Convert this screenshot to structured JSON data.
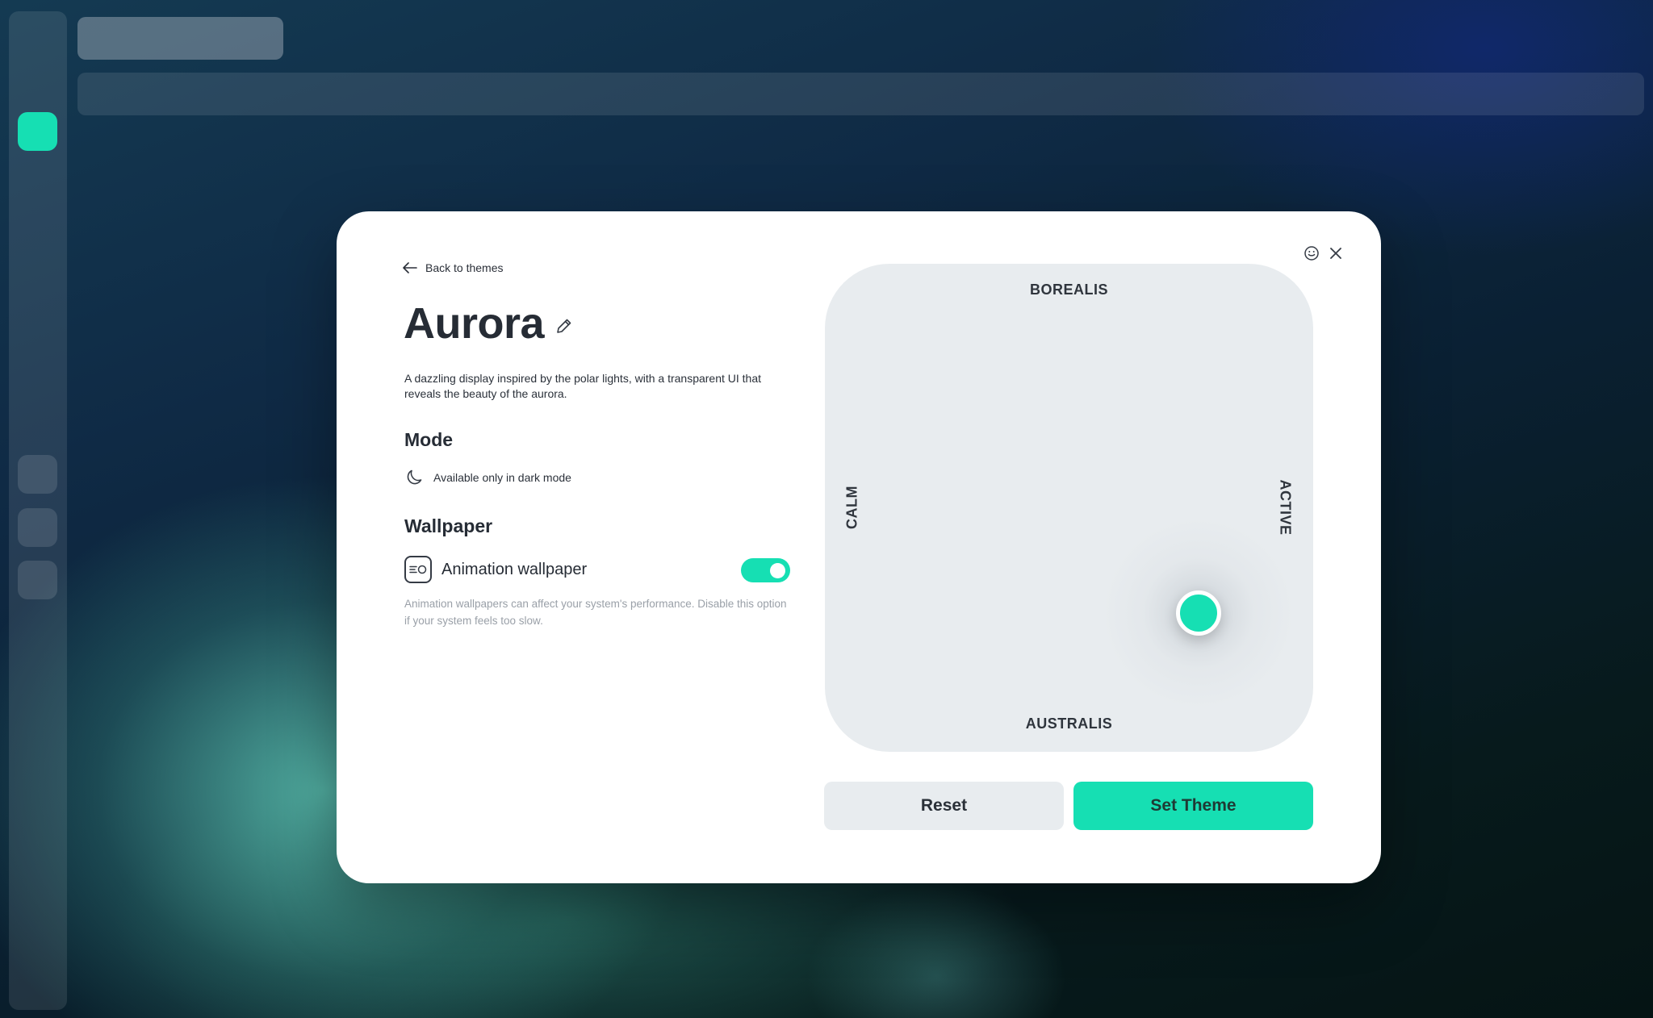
{
  "theme": {
    "back_label": "Back to themes",
    "title": "Aurora",
    "description": "A dazzling display inspired by the polar lights, with a transparent UI that reveals the beauty of the aurora."
  },
  "mode": {
    "heading": "Mode",
    "text": "Available only in dark mode",
    "icon": "moon-icon"
  },
  "wallpaper": {
    "heading": "Wallpaper",
    "label": "Animation wallpaper",
    "icon": "animation-wallpaper-icon",
    "enabled": true,
    "note": "Animation wallpapers can affect your system's performance. Disable this option if your system feels too slow."
  },
  "pad": {
    "top_label": "BOREALIS",
    "bottom_label": "AUSTRALIS",
    "left_label": "CALM",
    "right_label": "ACTIVE"
  },
  "buttons": {
    "reset_label": "Reset",
    "set_label": "Set Theme"
  },
  "top_icons": [
    "smiley-icon",
    "close-icon"
  ],
  "colors": {
    "accent": "#16dfb3",
    "dialog_bg": "#ffffff",
    "pad_bg": "#e8ecef",
    "text_primary": "#262c35",
    "text_muted": "#9aa0a8"
  }
}
